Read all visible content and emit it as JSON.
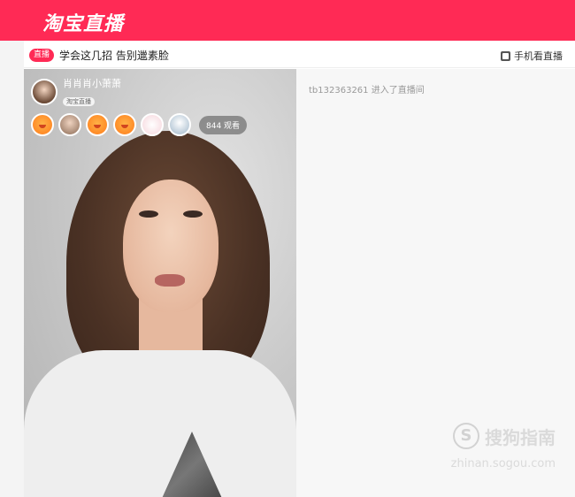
{
  "header": {
    "logo_text": "淘宝直播",
    "brand_color": "#ff2a55"
  },
  "subbar": {
    "live_badge": "直播",
    "title": "学会这几招 告别邋素脸",
    "mobile_label": "手机看直播"
  },
  "video": {
    "anchor_name": "肖肖肖小萧萧",
    "anchor_tag": "淘宝直播",
    "viewers_count_label": "844 观看",
    "viewer_icons": [
      "orange-avatar-icon",
      "photo-avatar-icon",
      "orange-avatar-icon",
      "orange-avatar-icon",
      "pink-avatar-icon",
      "photo-avatar-icon"
    ]
  },
  "chat": {
    "messages": [
      {
        "text": "tb132363261 进入了直播间"
      }
    ]
  },
  "watermark": {
    "text": "搜狗指南",
    "symbol": "S",
    "url": "zhinan.sogou.com"
  }
}
